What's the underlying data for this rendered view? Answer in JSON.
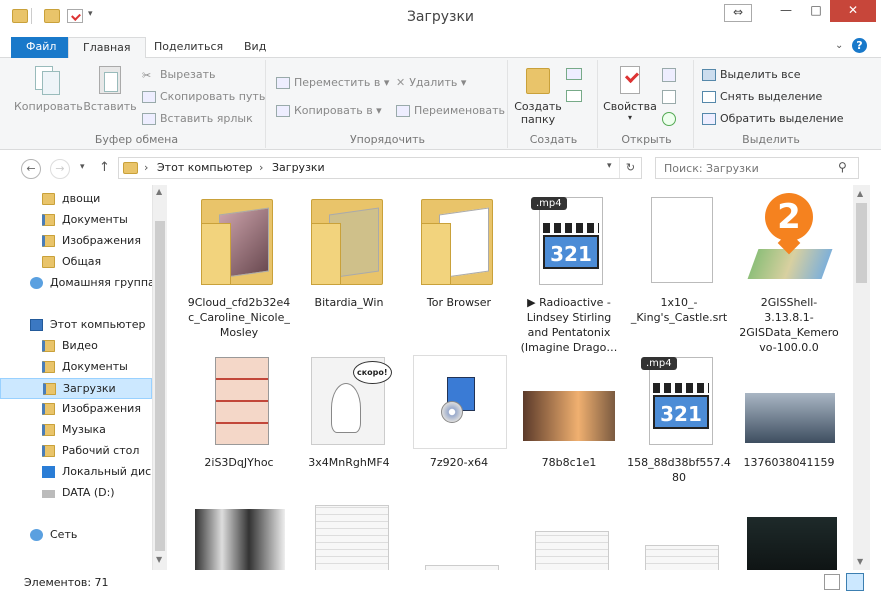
{
  "window": {
    "title": "Загрузки"
  },
  "ribbon_tabs": [
    "Файл",
    "Главная",
    "Поделиться",
    "Вид"
  ],
  "clipboard": {
    "copy": "Копировать",
    "paste": "Вставить",
    "cut": "Вырезать",
    "copy_path": "Скопировать путь",
    "paste_shortcut": "Вставить ярлык",
    "label": "Буфер обмена"
  },
  "organize": {
    "move_to": "Переместить в",
    "copy_to": "Копировать в",
    "delete": "Удалить",
    "rename": "Переименовать",
    "label": "Упорядочить"
  },
  "new": {
    "new_folder": "Создать папку",
    "label": "Создать"
  },
  "open": {
    "properties": "Свойства",
    "label": "Открыть"
  },
  "select": {
    "select_all": "Выделить все",
    "select_none": "Снять выделение",
    "invert": "Обратить выделение",
    "label": "Выделить"
  },
  "address": {
    "root": "Этот компьютер",
    "current": "Загрузки"
  },
  "search": {
    "placeholder": "Поиск: Загрузки"
  },
  "nav": [
    {
      "label": "двощи",
      "icon": "folder-icon",
      "indent": 1
    },
    {
      "label": "Документы",
      "icon": "library-icon",
      "indent": 1
    },
    {
      "label": "Изображения",
      "icon": "library-icon",
      "indent": 1
    },
    {
      "label": "Общая",
      "icon": "folder-icon",
      "indent": 1
    },
    {
      "label": "Домашняя группа",
      "icon": "homegroup-icon",
      "indent": 0
    },
    {
      "label": "",
      "icon": "",
      "indent": 0
    },
    {
      "label": "Этот компьютер",
      "icon": "computer-icon",
      "indent": 0
    },
    {
      "label": "Видео",
      "icon": "library-icon",
      "indent": 1
    },
    {
      "label": "Документы",
      "icon": "library-icon",
      "indent": 1
    },
    {
      "label": "Загрузки",
      "icon": "download-folder-icon",
      "indent": 1,
      "selected": true
    },
    {
      "label": "Изображения",
      "icon": "library-icon",
      "indent": 1
    },
    {
      "label": "Музыка",
      "icon": "library-icon",
      "indent": 1
    },
    {
      "label": "Рабочий стол",
      "icon": "library-icon",
      "indent": 1
    },
    {
      "label": "Локальный диск",
      "icon": "windows-drive-icon",
      "indent": 1
    },
    {
      "label": "DATA (D:)",
      "icon": "drive-icon",
      "indent": 1
    },
    {
      "label": "",
      "icon": "",
      "indent": 0
    },
    {
      "label": "Сеть",
      "icon": "network-icon",
      "indent": 0
    }
  ],
  "files": [
    {
      "name": "9Cloud_cfd2b32e4c_Caroline_Nicole_Mosley",
      "kind": "folder-photo"
    },
    {
      "name": "Bitardia_Win",
      "kind": "folder-face"
    },
    {
      "name": "Tor Browser",
      "kind": "folder-doc"
    },
    {
      "name": "▶ Radioactive - Lindsey Stirling and Pentatonix (Imagine Drago…",
      "kind": "mp4",
      "badge": ".mp4",
      "glyph": "321"
    },
    {
      "name": "1x10_-_King's_Castle.srt",
      "kind": "blank"
    },
    {
      "name": "2GISShell-3.13.8.1-2GISData_Kemerovo-100.0.0",
      "kind": "2gis",
      "glyph": "2"
    },
    {
      "name": "2iS3DqJYhoc",
      "kind": "image-comic"
    },
    {
      "name": "3x4MnRghMF4",
      "kind": "image-sketch",
      "glyph": "скоро!"
    },
    {
      "name": "7z920-x64",
      "kind": "installer"
    },
    {
      "name": "78b8c1e1",
      "kind": "image-warm"
    },
    {
      "name": "158_88d38bf557.480",
      "kind": "mp4",
      "badge": ".mp4",
      "glyph": "321"
    },
    {
      "name": "1376038041159",
      "kind": "image-train"
    },
    {
      "name": "",
      "kind": "image-bottles"
    },
    {
      "name": "",
      "kind": "image-screenshot"
    },
    {
      "name": "",
      "kind": "image-screenshot"
    },
    {
      "name": "",
      "kind": "image-screenshot"
    },
    {
      "name": "",
      "kind": "image-screenshot"
    },
    {
      "name": "",
      "kind": "image-dark"
    }
  ],
  "status": {
    "count": "Элементов: 71"
  },
  "colors": {
    "accent": "#1979ca",
    "close": "#c7463a",
    "folder": "#e9c46a",
    "selected_nav": "#cce8ff"
  }
}
